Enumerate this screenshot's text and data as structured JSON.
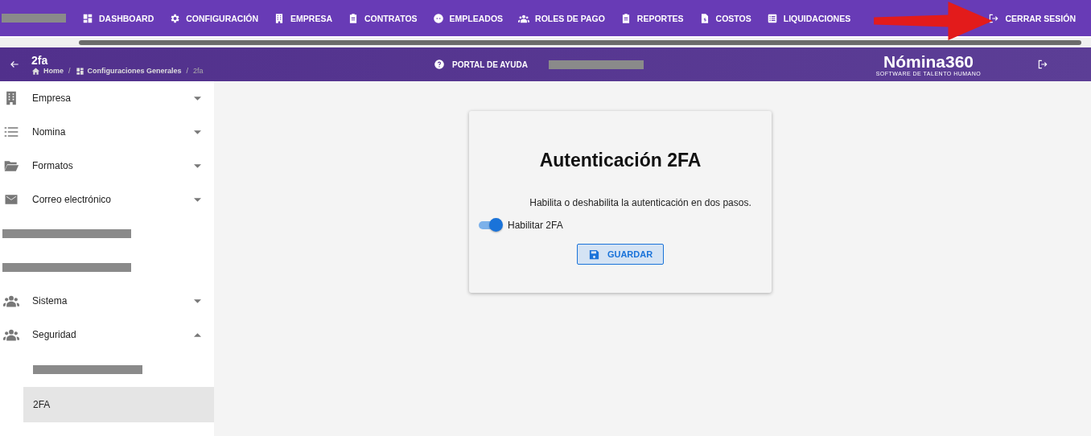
{
  "top_nav": [
    {
      "label": "DASHBOARD"
    },
    {
      "label": "CONFIGURACIÓN"
    },
    {
      "label": "EMPRESA"
    },
    {
      "label": "CONTRATOS"
    },
    {
      "label": "EMPLEADOS"
    },
    {
      "label": "ROLES DE PAGO"
    },
    {
      "label": "REPORTES"
    },
    {
      "label": "COSTOS"
    },
    {
      "label": "LIQUIDACIONES"
    }
  ],
  "logout": {
    "label": "CERRAR SESIÓN"
  },
  "header": {
    "title": "2fa",
    "breadcrumb": [
      {
        "label": "Home"
      },
      {
        "label": "Configuraciones Generales"
      },
      {
        "label": "2fa"
      }
    ],
    "separator": "/",
    "help": "PORTAL DE AYUDA",
    "logo": "Nómina360",
    "logo_tagline": "SOFTWARE DE TALENTO HUMANO"
  },
  "sidebar": {
    "items": [
      {
        "kind": "group",
        "label": "Empresa",
        "expanded": false
      },
      {
        "kind": "group",
        "label": "Nomina",
        "expanded": false
      },
      {
        "kind": "group",
        "label": "Formatos",
        "expanded": false
      },
      {
        "kind": "group",
        "label": "Correo electrónico",
        "expanded": false
      },
      {
        "kind": "redacted"
      },
      {
        "kind": "redacted"
      },
      {
        "kind": "group",
        "label": "Sistema",
        "expanded": false
      },
      {
        "kind": "group",
        "label": "Seguridad",
        "expanded": true,
        "children": [
          {
            "kind": "redacted",
            "selected": false
          },
          {
            "kind": "child",
            "label": "2FA",
            "selected": true
          }
        ]
      }
    ]
  },
  "card": {
    "title": "Autenticación 2FA",
    "description": "Habilita o deshabilita la autenticación en dos pasos.",
    "toggle": {
      "label": "Habilitar 2FA",
      "on": true
    },
    "button": "GUARDAR"
  }
}
